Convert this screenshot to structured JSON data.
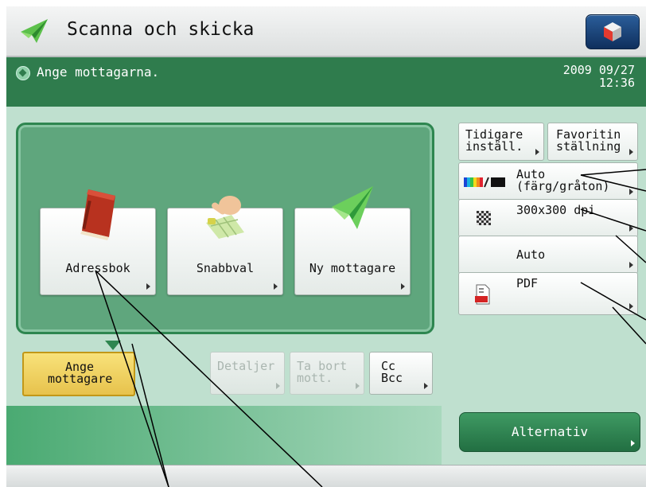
{
  "header": {
    "title": "Scanna och skicka",
    "monitor_icon": "monitor-icon"
  },
  "status": {
    "message": "Ange mottagarna.",
    "date": "2009 09/27",
    "time": "12:36"
  },
  "destinations": {
    "buttons": [
      {
        "label": "Adressbok",
        "icon": "address-book-icon"
      },
      {
        "label": "Snabbval",
        "icon": "one-touch-icon"
      },
      {
        "label": "Ny mottagare",
        "icon": "paper-plane-icon"
      }
    ]
  },
  "actions": {
    "specify": [
      "Ange",
      "mottagare"
    ],
    "details": "Detaljer",
    "remove": [
      "Ta bort",
      "mott."
    ],
    "ccbcc": [
      "Cc",
      "Bcc"
    ]
  },
  "settings": {
    "previous": [
      "Tidigare",
      "inställ."
    ],
    "favorite": [
      "Favoritin",
      "ställning"
    ],
    "color": [
      "Auto",
      "(färg/gråton)"
    ],
    "resolution": "300x300 dpi",
    "density": "Auto",
    "format": "PDF",
    "options": "Alternativ"
  },
  "colors": {
    "status_green": "#2f7c4d",
    "panel_green": "#5fa67d",
    "active_yellow": "#e7c24c",
    "background": "#bfe0cf"
  }
}
